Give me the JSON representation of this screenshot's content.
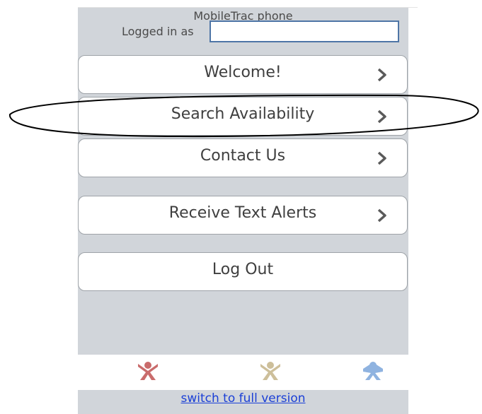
{
  "header": {
    "title": "MobileTrac phone",
    "logged_in_label": "Logged in as",
    "logged_in_value": ""
  },
  "menu": {
    "items": [
      {
        "label": "Welcome!",
        "chevron": true
      },
      {
        "label": "Search Availability",
        "chevron": true
      },
      {
        "label": "Contact Us",
        "chevron": true
      },
      {
        "label": "Receive Text Alerts",
        "chevron": true
      },
      {
        "label": "Log Out",
        "chevron": false
      }
    ]
  },
  "footer": {
    "icons": [
      "red-figure-icon",
      "tan-figure-icon",
      "blue-figure-icon"
    ],
    "icon_colors": [
      "#c96b6b",
      "#cdbf9a",
      "#8fb3e0"
    ],
    "switch_link": "switch to full version"
  },
  "annotation": {
    "shape": "ellipse",
    "color": "#000000"
  }
}
